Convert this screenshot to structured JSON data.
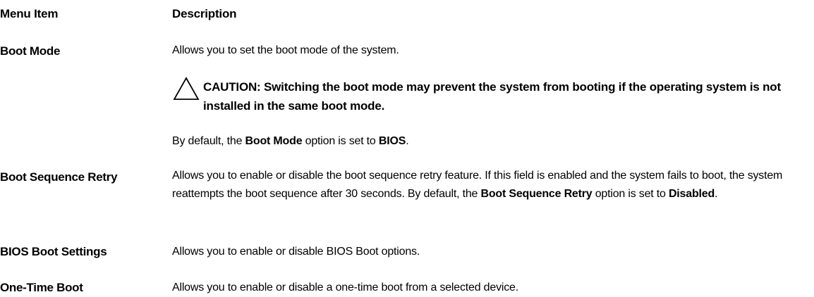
{
  "header": {
    "menu_item": "Menu Item",
    "description": "Description"
  },
  "rows": [
    {
      "label": "Boot Mode",
      "description": "Allows you to set the boot mode of the system.",
      "caution": "CAUTION: Switching the boot mode may prevent the system from booting if the operating system is not installed in the same boot mode.",
      "default_prefix": "By default, the ",
      "default_bold1": "Boot Mode",
      "default_middle": " option is set to ",
      "default_bold2": "BIOS",
      "default_suffix": "."
    },
    {
      "label": "Boot Sequence Retry",
      "description": "Allows you to enable or disable the boot sequence retry feature. If this field is enabled and the system fails to boot, the system reattempts the boot sequence after 30 seconds. By default, the ",
      "bold1": "Boot Sequence Retry",
      "middle": " option is set to ",
      "bold2": "Disabled",
      "suffix": "."
    },
    {
      "label": "BIOS Boot Settings",
      "description": "Allows you to enable or disable BIOS Boot options."
    },
    {
      "label": "One-Time Boot",
      "description": "Allows you to enable or disable a one-time boot from a selected device."
    }
  ],
  "icons": {
    "caution": "caution-triangle-icon"
  }
}
